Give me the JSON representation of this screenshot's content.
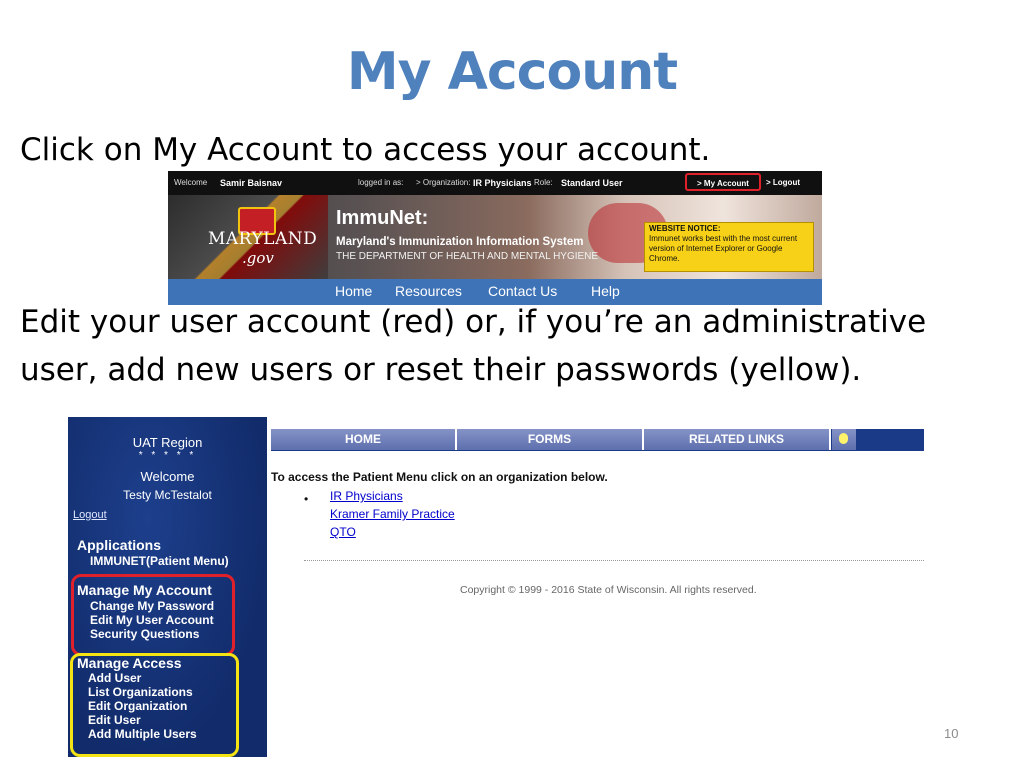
{
  "slide": {
    "title": "My Account",
    "caption1": "Click on My Account to access your account.",
    "caption2": "Edit your user account (red) or, if you’re an administrative user, add new users or reset their passwords (yellow).",
    "page_number": "10"
  },
  "immunet": {
    "welcome_label": "Welcome",
    "user_name": "Samir Baisnav",
    "logged_in_as": "logged in as:",
    "org_label": "> Organization:",
    "org_name": "IR Physicians",
    "role_label": "Role:",
    "role_name": "Standard User",
    "my_account": "> My Account",
    "logout": "> Logout",
    "state_logo": "MARYLAND",
    "state_gov": ".gov",
    "app_name": "ImmuNet:",
    "subtitle": "Maryland's Immunization Information System",
    "department": "THE DEPARTMENT OF HEALTH AND MENTAL HYGIENE",
    "notice_title": "WEBSITE NOTICE:",
    "notice_text": "Immunet works best with the most current version of Internet Explorer or Google Chrome.",
    "nav": [
      "Home",
      "Resources",
      "Contact Us",
      "Help"
    ]
  },
  "wisconsin": {
    "region": "UAT Region",
    "stars": "* * * * *",
    "welcome": "Welcome",
    "user": "Testy McTestalot",
    "logout": "Logout",
    "applications": {
      "heading": "Applications",
      "items": [
        "IMMUNET(Patient Menu)"
      ]
    },
    "manage_account": {
      "heading": "Manage My Account",
      "items": [
        "Change My Password",
        "Edit My User Account",
        "Security Questions"
      ]
    },
    "manage_access": {
      "heading": "Manage Access",
      "items": [
        "Add User",
        "List Organizations",
        "Edit Organization",
        "Edit User",
        "Add Multiple Users"
      ]
    },
    "tabs": [
      "HOME",
      "FORMS",
      "RELATED LINKS"
    ],
    "intro": "To access the Patient Menu click on an organization below.",
    "bullet": "•",
    "organizations": [
      "IR Physicians",
      "Kramer Family Practice",
      "QTO"
    ],
    "copyright": "Copyright © 1999 - 2016 State of Wisconsin. All rights reserved."
  },
  "colors": {
    "title": "#4f81bd",
    "red_highlight": "#e0202a",
    "yellow_highlight": "#f5e414",
    "nav_blue": "#3e73b7",
    "sidebar_navy": "#122c6b"
  }
}
